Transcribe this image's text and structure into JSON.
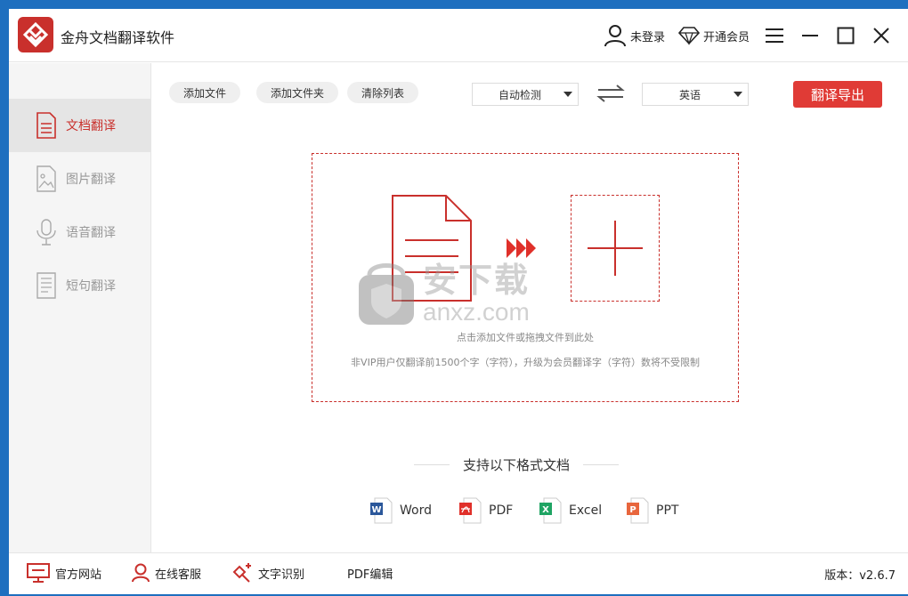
{
  "app": {
    "title": "金舟文档翻译软件"
  },
  "titlebar": {
    "login_label": "未登录",
    "vip_label": "开通会员"
  },
  "sidebar": {
    "items": [
      {
        "label": "文档翻译",
        "icon": "document-icon",
        "active": true
      },
      {
        "label": "图片翻译",
        "icon": "image-icon",
        "active": false
      },
      {
        "label": "语音翻译",
        "icon": "microphone-icon",
        "active": false
      },
      {
        "label": "短句翻译",
        "icon": "text-icon",
        "active": false
      }
    ]
  },
  "toolbar": {
    "add_file": "添加文件",
    "add_folder": "添加文件夹",
    "clear_list": "清除列表",
    "source_lang": "自动检测",
    "target_lang": "英语",
    "export_label": "翻译导出"
  },
  "dropzone": {
    "hint": "点击添加文件或拖拽文件到此处",
    "note": "非VIP用户仅翻译前1500个字（字符），升级为会员翻译字（字符）数将不受限制"
  },
  "watermark": {
    "cn": "安下载",
    "en": "anxz.com"
  },
  "formats": {
    "title": "支持以下格式文档",
    "items": [
      {
        "label": "Word",
        "color": "#2b579a",
        "badge": "W"
      },
      {
        "label": "PDF",
        "color": "#e0302a",
        "badge": "P"
      },
      {
        "label": "Excel",
        "color": "#1fa463",
        "badge": "X"
      },
      {
        "label": "PPT",
        "color": "#e8663d",
        "badge": "P"
      }
    ]
  },
  "footer": {
    "website": "官方网站",
    "support": "在线客服",
    "ocr": "文字识别",
    "pdf_edit": "PDF编辑",
    "version": "版本：v2.6.7"
  },
  "colors": {
    "accent": "#c9302c",
    "button": "#e03b36"
  }
}
